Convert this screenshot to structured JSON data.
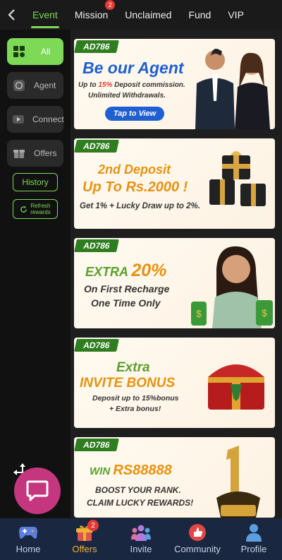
{
  "top_tabs": [
    {
      "label": "Event",
      "active": true
    },
    {
      "label": "Mission",
      "badge": "2"
    },
    {
      "label": "Unclaimed"
    },
    {
      "label": "Fund"
    },
    {
      "label": "VIP"
    }
  ],
  "sidebar": {
    "items": [
      {
        "label": "All",
        "icon": "grid-icon",
        "active": true
      },
      {
        "label": "Agent",
        "icon": "whatsapp-icon"
      },
      {
        "label": "Connect",
        "icon": "youtube-icon"
      },
      {
        "label": "Offers",
        "icon": "gift-icon"
      }
    ],
    "history_label": "History",
    "refresh_label_1": "Refresh",
    "refresh_label_2": "rewards"
  },
  "banners": [
    {
      "logo": "AD786",
      "title": "Be our Agent",
      "line1_pre": "Up to ",
      "line1_hl": "15%",
      "line1_post": " Deposit commission.",
      "line2": "Unlimited Withdrawals.",
      "button": "Tap to View"
    },
    {
      "logo": "AD786",
      "title1": "2nd Deposit",
      "title2": "Up To Rs.2000 !",
      "sub": "Get 1% + Lucky Draw up to 2%."
    },
    {
      "logo": "AD786",
      "title_a": "EXTRA ",
      "title_b": "20%",
      "sub1": "On First Recharge",
      "sub2": "One Time Only"
    },
    {
      "logo": "AD786",
      "title1": "Extra",
      "title2": "INVITE BONUS",
      "sub1": "Deposit up to 15%bonus",
      "sub2": "+ Extra bonus!"
    },
    {
      "logo": "AD786",
      "title_a": "WIN ",
      "title_b": "RS88888",
      "sub1": "BOOST YOUR RANK.",
      "sub2": "CLAIM LUCKY REWARDS!"
    }
  ],
  "bottom_nav": [
    {
      "label": "Home",
      "icon": "gamepad-icon"
    },
    {
      "label": "Offers",
      "icon": "gift-icon",
      "badge": "2",
      "active": true
    },
    {
      "label": "Invite",
      "icon": "people-icon"
    },
    {
      "label": "Community",
      "icon": "thumbs-up-icon"
    },
    {
      "label": "Profile",
      "icon": "person-icon"
    }
  ],
  "colors": {
    "accent": "#7ed957",
    "nav_bg": "#1a2740",
    "active_nav": "#f2b233",
    "fab": "#c4367e",
    "badge": "#e53935"
  }
}
